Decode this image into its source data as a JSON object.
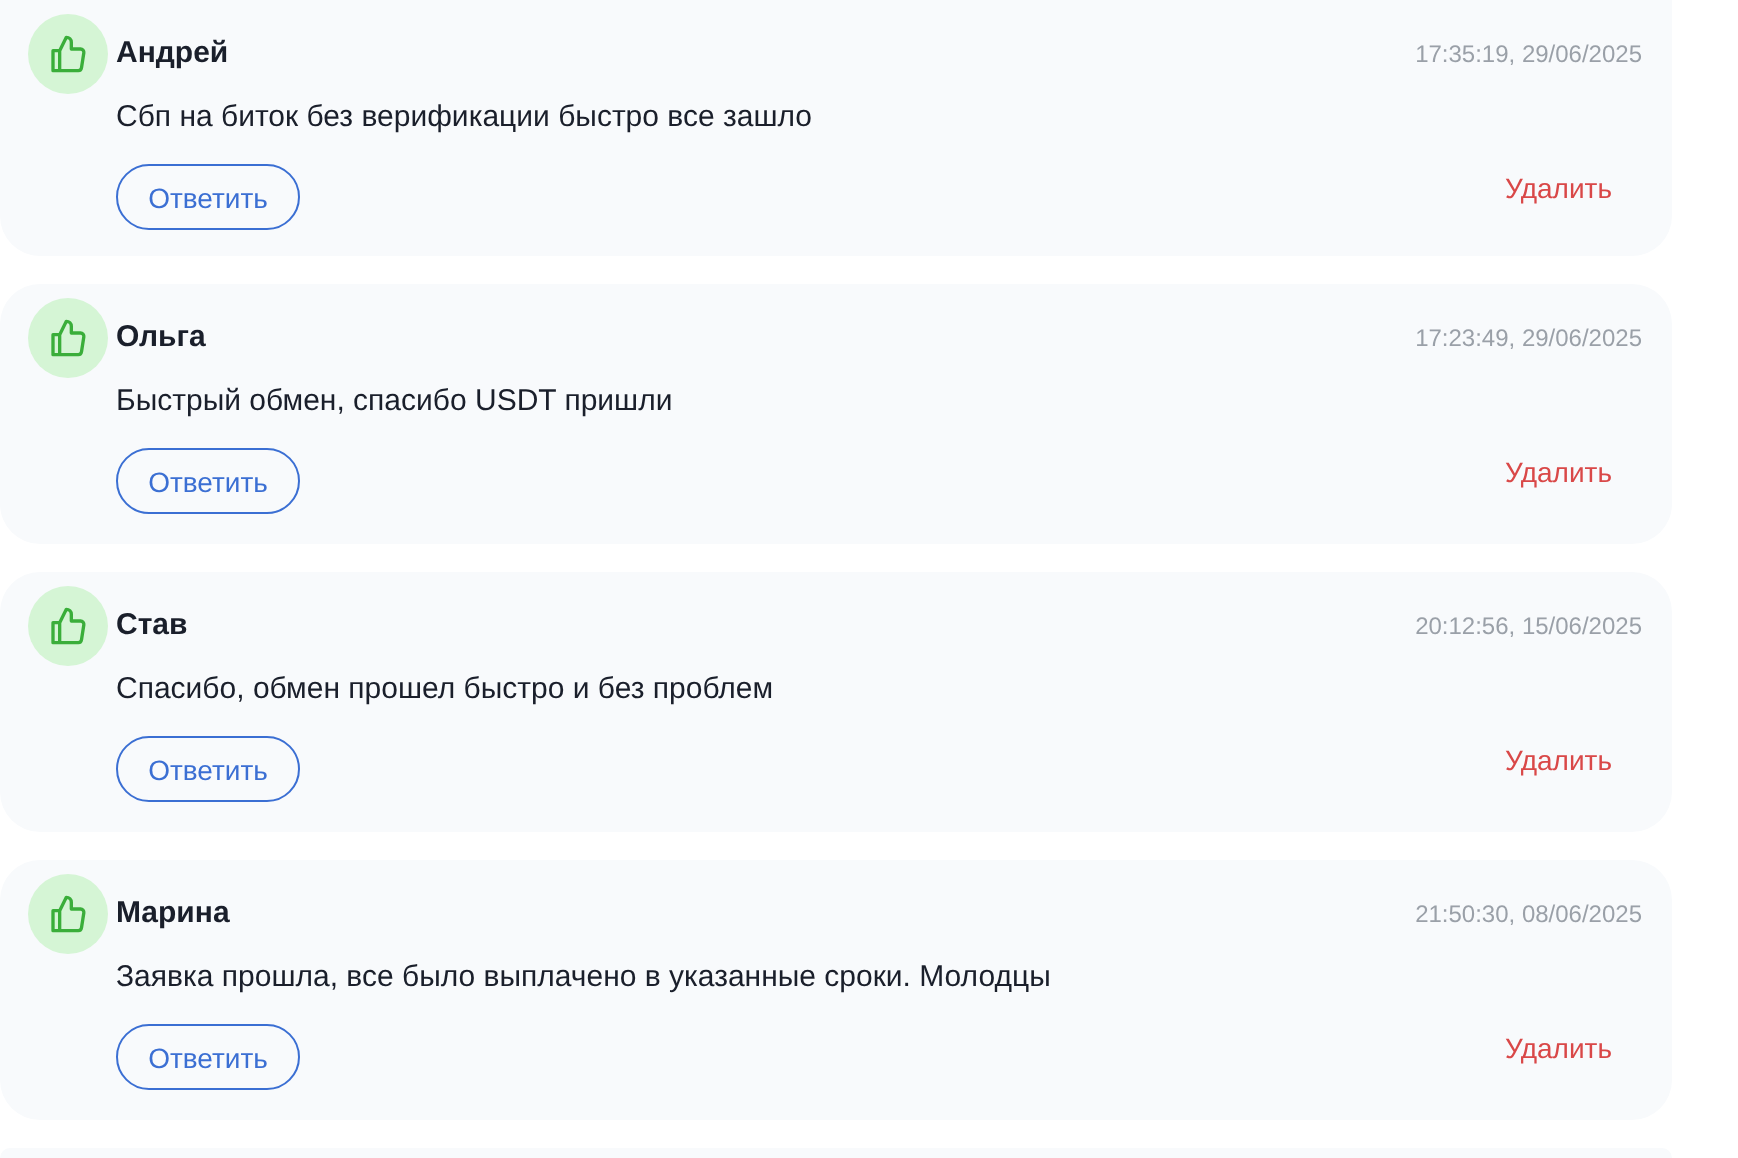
{
  "reviews": [
    {
      "author": "Андрей",
      "time": "17:35:19, 29/06/2025",
      "text": "Сбп на биток без верификации быстро все зашло",
      "reply_label": "Ответить",
      "delete_label": "Удалить",
      "positive": true
    },
    {
      "author": "Ольга",
      "time": "17:23:49, 29/06/2025",
      "text": "Быстрый обмен, спасибо USDT пришли",
      "reply_label": "Ответить",
      "delete_label": "Удалить",
      "positive": true
    },
    {
      "author": "Став",
      "time": "20:12:56, 15/06/2025",
      "text": "Спасибо, обмен прошел быстро и без проблем",
      "reply_label": "Ответить",
      "delete_label": "Удалить",
      "positive": true
    },
    {
      "author": "Марина",
      "time": "21:50:30, 08/06/2025",
      "text": "Заявка прошла, все было выплачено в указанные сроки. Молодцы",
      "reply_label": "Ответить",
      "delete_label": "Удалить",
      "positive": true
    }
  ]
}
